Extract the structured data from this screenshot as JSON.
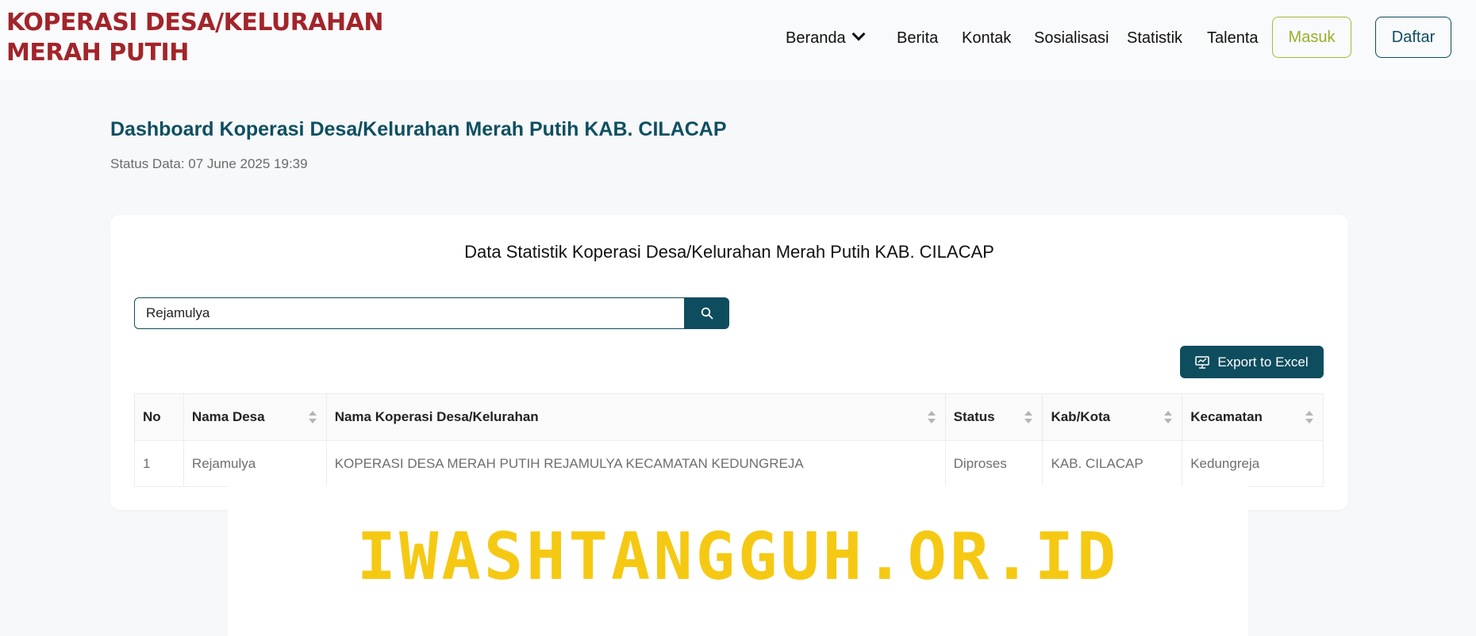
{
  "brand": {
    "line1": "KOPERASI DESA/KELURAHAN",
    "line2": "MERAH PUTIH",
    "color": "#a2242a"
  },
  "nav": {
    "items": [
      "Beranda",
      "Berita",
      "Kontak",
      "Sosialisasi",
      "Statistik",
      "Talenta"
    ],
    "login_label": "Masuk",
    "register_label": "Daftar"
  },
  "page": {
    "title": "Dashboard Koperasi Desa/Kelurahan Merah Putih KAB. CILACAP",
    "status": "Status Data: 07 June 2025 19:39"
  },
  "card": {
    "title": "Data Statistik Koperasi Desa/Kelurahan Merah Putih KAB. CILACAP",
    "search_value": "Rejamulya",
    "export_label": "Export to Excel"
  },
  "table": {
    "headers": [
      "No",
      "Nama Desa",
      "Nama Koperasi Desa/Kelurahan",
      "Status",
      "Kab/Kota",
      "Kecamatan"
    ],
    "rows": [
      [
        "1",
        "Rejamulya",
        "KOPERASI DESA MERAH PUTIH REJAMULYA KECAMATAN KEDUNGREJA",
        "Diproses",
        "KAB. CILACAP",
        "Kedungreja"
      ]
    ]
  },
  "watermark": {
    "text": "IWASHTANGGUH.OR.ID",
    "color": "#f5c913"
  },
  "colors": {
    "primary": "#0d4d5e",
    "accent_green": "#9aae2a"
  }
}
